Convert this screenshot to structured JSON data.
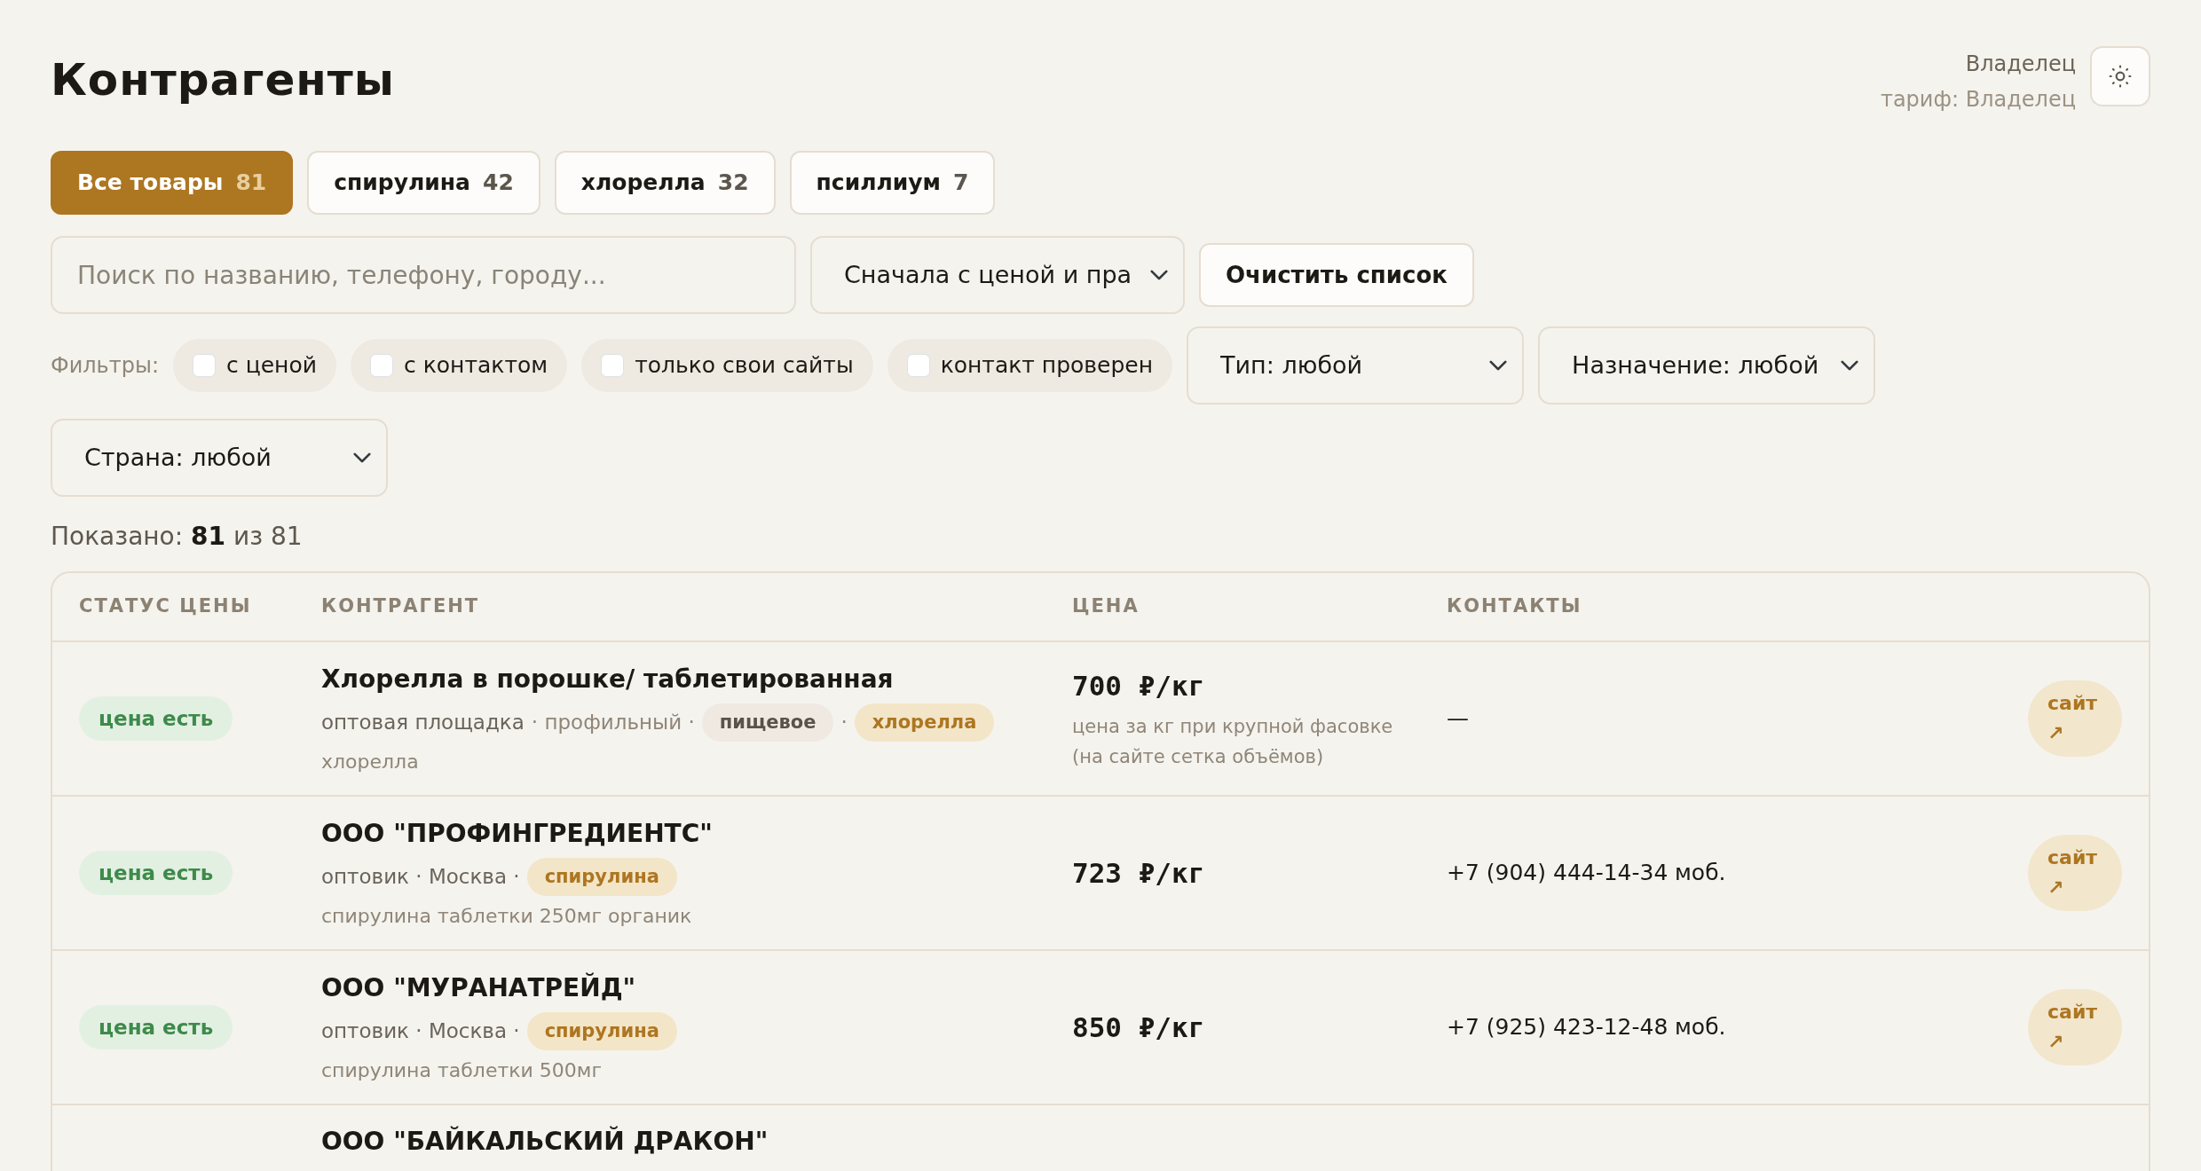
{
  "title": "Контрагенты",
  "user": {
    "name": "Владелец",
    "plan": "тариф: Владелец"
  },
  "tabs": [
    {
      "label": "Все товары",
      "count": "81",
      "selected": true
    },
    {
      "label": "спирулина",
      "count": "42",
      "selected": false
    },
    {
      "label": "хлорелла",
      "count": "32",
      "selected": false
    },
    {
      "label": "псиллиум",
      "count": "7",
      "selected": false
    }
  ],
  "search": {
    "placeholder": "Поиск по названию, телефону, городу..."
  },
  "sort": {
    "value": "Сначала с ценой и пра"
  },
  "clear_button": "Очистить список",
  "filters": {
    "label": "Фильтры:",
    "checkboxes": [
      {
        "label": "с ценой",
        "checked": false
      },
      {
        "label": "с контактом",
        "checked": false
      },
      {
        "label": "только свои сайты",
        "checked": false
      },
      {
        "label": "контакт проверен",
        "checked": false
      }
    ],
    "selects": [
      "Тип: любой",
      "Назначение: любой",
      "Страна: любой"
    ]
  },
  "shown": "Показано: **81** из 81",
  "table": {
    "columns": [
      "СТАТУС ЦЕНЫ",
      "КОНТРАГЕНТ",
      "ЦЕНА",
      "КОНТАКТЫ"
    ],
    "rows": [
      {
        "status": "цена есть",
        "name": "Хлорелла в порошке/ таблетированная",
        "meta": [
          {
            "kind": "text",
            "text": "оптовая площадка"
          },
          {
            "kind": "muted",
            "text": "· профильный ·"
          },
          {
            "kind": "tag",
            "text": "пищевое",
            "color": "#efe9e1"
          },
          {
            "kind": "muted",
            "text": "·"
          },
          {
            "kind": "tag",
            "text": "хлорелла",
            "color": "#f3e5c8"
          }
        ],
        "note": "хлорелла",
        "price": "700 ₽/кг",
        "price_note": "цена за кг при крупной фасовке (на сайте сетка объёмов)",
        "phone": "—",
        "site": "сайт ↗"
      },
      {
        "status": "цена есть",
        "name": "ООО \"ПРОФИНГРЕДИЕНТС\"",
        "meta": [
          {
            "kind": "text",
            "text": "оптовик · Москва ·"
          },
          {
            "kind": "tag",
            "text": "спирулина",
            "color": "#f3e5c8"
          }
        ],
        "note": "спирулина таблетки 250мг органик",
        "price": "723 ₽/кг",
        "phone": "+7 (904) 444-14-34",
        "phone_note": "моб.",
        "site": "сайт ↗"
      },
      {
        "status": "цена есть",
        "name": "ООО \"МУРАНАТРЕЙД\"",
        "meta": [
          {
            "kind": "text",
            "text": "оптовик · Москва ·"
          },
          {
            "kind": "tag",
            "text": "спирулина",
            "color": "#f3e5c8"
          }
        ],
        "note": "спирулина таблетки 500мг",
        "price": "850 ₽/кг",
        "phone": "+7 (925) 423-12-48",
        "phone_note": "моб.",
        "site": "сайт ↗"
      },
      {
        "name": "ООО \"БАЙКАЛЬСКИЙ ДРАКОН\""
      }
    ]
  }
}
